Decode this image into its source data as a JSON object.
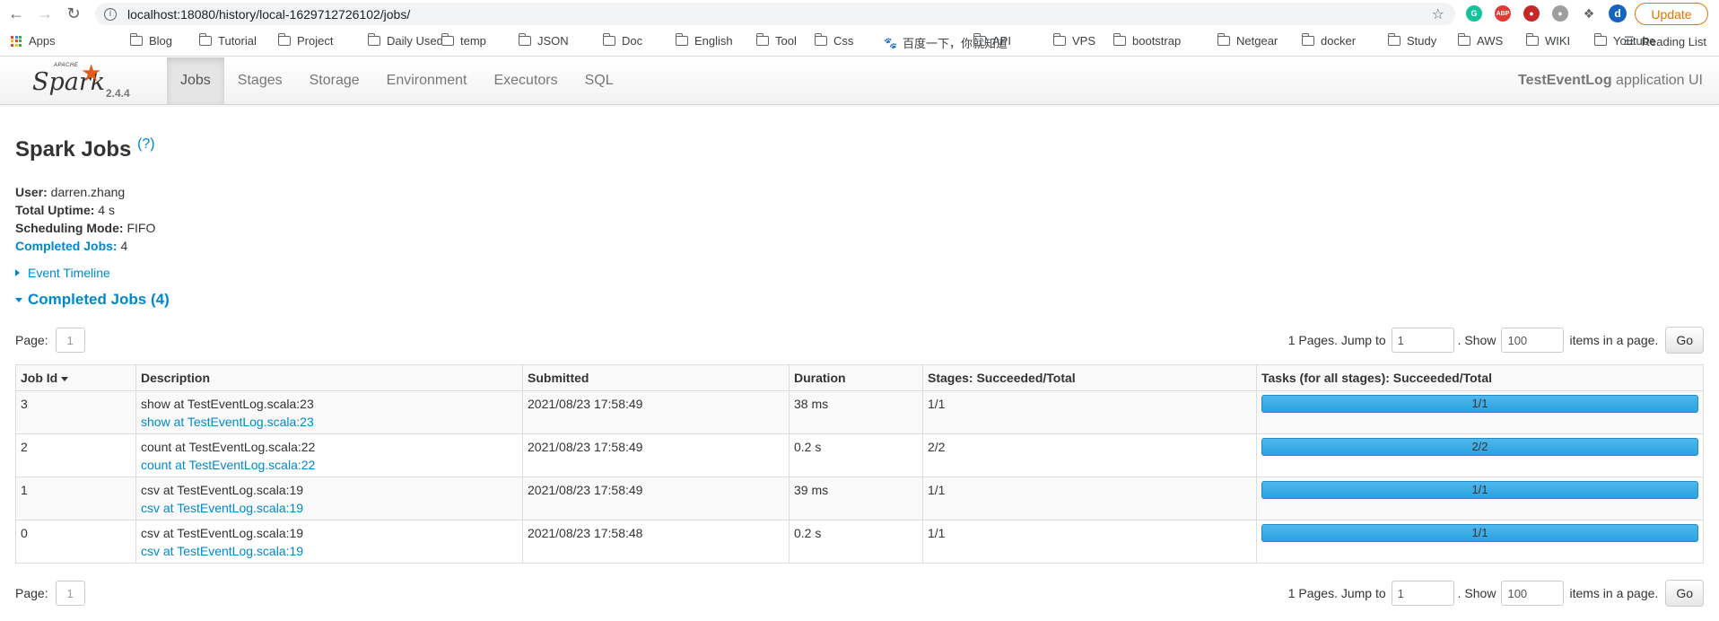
{
  "browser": {
    "url": "localhost:18080/history/local-1629712726102/jobs/",
    "update_label": "Update",
    "avatar_letter": "d",
    "bookmarks": [
      "Apps",
      "Blog",
      "Tutorial",
      "Project",
      "Daily Used",
      "temp",
      "JSON",
      "Doc",
      "English",
      "Tool",
      "Css",
      "百度一下，你就知道",
      "API",
      "VPS",
      "bootstrap",
      "Netgear",
      "docker",
      "Study",
      "AWS",
      "WIKI",
      "Youtube"
    ],
    "reading_list": "Reading List"
  },
  "navbar": {
    "logo_text": "Spark",
    "logo_apache": "APACHE",
    "version": "2.4.4",
    "tabs": [
      "Jobs",
      "Stages",
      "Storage",
      "Environment",
      "Executors",
      "SQL"
    ],
    "active_tab": "Jobs",
    "app_name": "TestEventLog",
    "app_suffix": " application UI"
  },
  "page": {
    "title": "Spark Jobs",
    "help": "(?)",
    "user_label": "User:",
    "user": " darren.zhang",
    "uptime_label": "Total Uptime:",
    "uptime": " 4 s",
    "mode_label": "Scheduling Mode:",
    "mode": " FIFO",
    "completed_label": "Completed Jobs:",
    "completed": " 4",
    "event_timeline": "Event Timeline",
    "completed_section": "Completed Jobs (4)"
  },
  "pager": {
    "page_label": "Page:",
    "page_value": "1",
    "pages_text": "1 Pages. Jump to",
    "jump_value": "1",
    "show_text": ". Show",
    "show_value": "100",
    "items_text": "items in a page.",
    "go_label": "Go"
  },
  "table": {
    "headers": [
      "Job Id",
      "Description",
      "Submitted",
      "Duration",
      "Stages: Succeeded/Total",
      "Tasks (for all stages): Succeeded/Total"
    ],
    "rows": [
      {
        "id": "3",
        "desc": "show at TestEventLog.scala:23",
        "link": "show at TestEventLog.scala:23",
        "submitted": "2021/08/23 17:58:49",
        "duration": "38 ms",
        "stages": "1/1",
        "tasks": "1/1",
        "progress": 1.0
      },
      {
        "id": "2",
        "desc": "count at TestEventLog.scala:22",
        "link": "count at TestEventLog.scala:22",
        "submitted": "2021/08/23 17:58:49",
        "duration": "0.2 s",
        "stages": "2/2",
        "tasks": "2/2",
        "progress": 1.0
      },
      {
        "id": "1",
        "desc": "csv at TestEventLog.scala:19",
        "link": "csv at TestEventLog.scala:19",
        "submitted": "2021/08/23 17:58:49",
        "duration": "39 ms",
        "stages": "1/1",
        "tasks": "1/1",
        "progress": 1.0
      },
      {
        "id": "0",
        "desc": "csv at TestEventLog.scala:19",
        "link": "csv at TestEventLog.scala:19",
        "submitted": "2021/08/23 17:58:48",
        "duration": "0.2 s",
        "stages": "1/1",
        "tasks": "1/1",
        "progress": 1.0
      }
    ]
  }
}
